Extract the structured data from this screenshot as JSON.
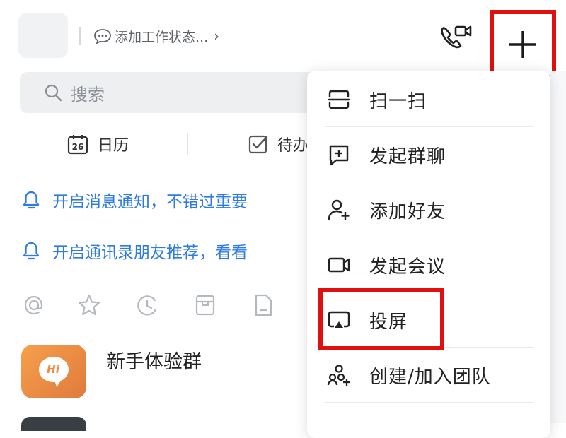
{
  "header": {
    "status_label": "添加工作状态...",
    "status_chevron": "›",
    "video_call_icon": "video-call-icon",
    "add_icon": "plus-icon"
  },
  "search": {
    "placeholder": "搜索"
  },
  "quick_tabs": [
    {
      "label": "日历",
      "badge": "26",
      "icon": "calendar-icon"
    },
    {
      "label": "待办",
      "icon": "checkbox-icon"
    }
  ],
  "notices": [
    {
      "text": "开启消息通知，不错过重要",
      "icon": "bell-icon"
    },
    {
      "text": "开启通讯录朋友推荐，看看",
      "icon": "bell-icon"
    }
  ],
  "filter_icons": [
    "at-icon",
    "star-icon",
    "clock-icon",
    "inbox-icon",
    "document-icon"
  ],
  "chats": [
    {
      "name": "新手体验群",
      "avatar_text": "Hi"
    }
  ],
  "menu": {
    "items": [
      {
        "label": "扫一扫",
        "icon": "scan-icon"
      },
      {
        "label": "发起群聊",
        "icon": "group-chat-icon"
      },
      {
        "label": "添加好友",
        "icon": "add-friend-icon"
      },
      {
        "label": "发起会议",
        "icon": "meeting-video-icon"
      },
      {
        "label": "投屏",
        "icon": "cast-screen-icon"
      },
      {
        "label": "创建/加入团队",
        "icon": "team-icon"
      }
    ]
  },
  "colors": {
    "accent_blue": "#2f7be5",
    "highlight_red": "#e01010",
    "avatar_orange": "#ef8a44"
  }
}
